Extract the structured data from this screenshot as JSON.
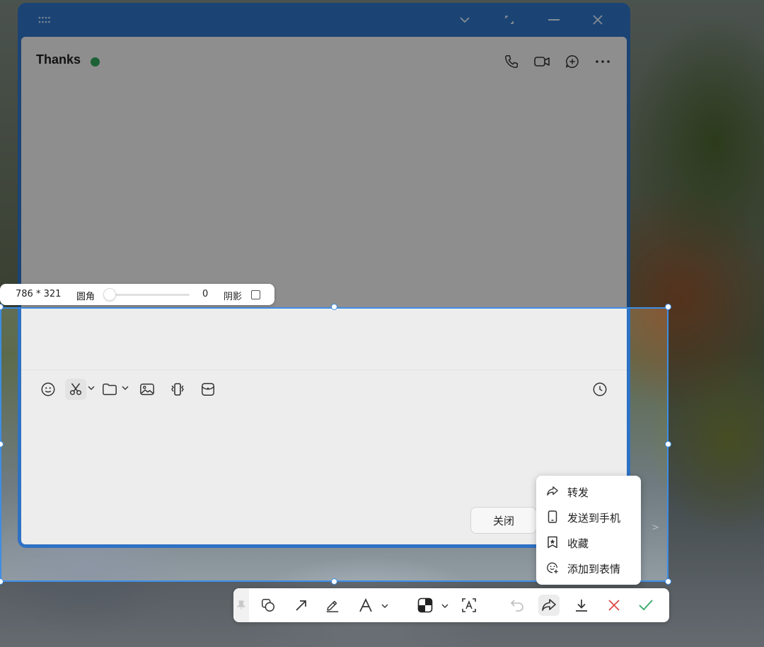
{
  "chat": {
    "contact_name": "Thanks",
    "close_label": "关闭"
  },
  "selection": {
    "size_text": "786 * 321",
    "corner_label": "圆角",
    "corner_value": "0",
    "shadow_label": "阴影"
  },
  "context_menu": {
    "items": [
      {
        "label": "转发",
        "icon": "forward-icon"
      },
      {
        "label": "发送到手机",
        "icon": "phone-icon"
      },
      {
        "label": "收藏",
        "icon": "bookmark-star-icon"
      },
      {
        "label": "添加到表情",
        "icon": "add-sticker-icon"
      }
    ]
  },
  "colors": {
    "window_accent": "#2e72c4",
    "online_status": "#2fa35a",
    "selection_border": "#3d8ee6",
    "cancel_red": "#e04848",
    "confirm_green": "#3aaa6a"
  }
}
